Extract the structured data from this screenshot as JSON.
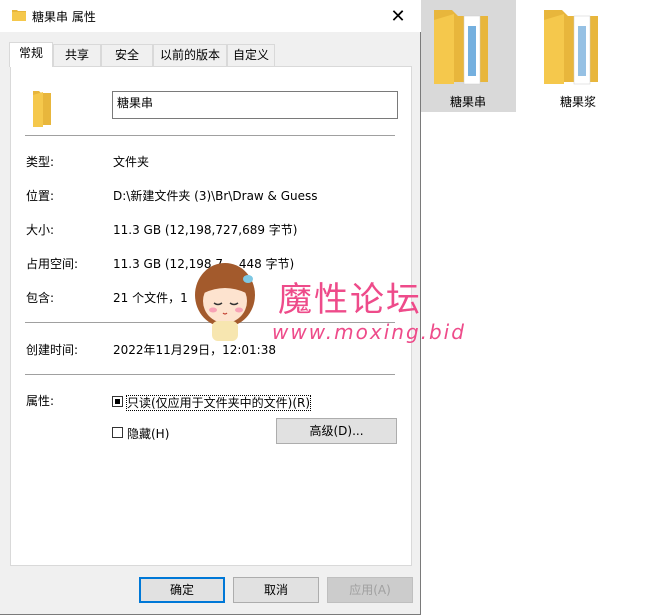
{
  "window": {
    "title": "糖果串 属性",
    "close_glyph": "✕"
  },
  "tabs": [
    {
      "label": "常规",
      "active": true
    },
    {
      "label": "共享"
    },
    {
      "label": "安全"
    },
    {
      "label": "以前的版本"
    },
    {
      "label": "自定义"
    }
  ],
  "general": {
    "name": "糖果串",
    "type_label": "类型:",
    "type_value": "文件夹",
    "location_label": "位置:",
    "location_value": "D:\\新建文件夹 (3)\\Br\\Draw & Guess",
    "size_label": "大小:",
    "size_value": "11.3 GB (12,198,727,689 字节)",
    "size_on_disk_label": "占用空间:",
    "size_on_disk_value": "11.3 GB (12,198,7__,448 字节)",
    "contains_label": "包含:",
    "contains_value": "21 个文件，1",
    "created_label": "创建时间:",
    "created_value": "2022年11月29日，12:01:38",
    "attributes_label": "属性:",
    "readonly_label": "只读(仅应用于文件夹中的文件)(R)",
    "hidden_label": "隐藏(H)",
    "advanced_label": "高级(D)..."
  },
  "footer": {
    "ok": "确定",
    "cancel": "取消",
    "apply": "应用(A)"
  },
  "explorer": {
    "items": [
      {
        "label": "糖果串",
        "selected": true
      },
      {
        "label": "糖果浆",
        "selected": false
      }
    ]
  },
  "watermark": {
    "title": "魔性论坛",
    "url": "www.moxing.bid"
  },
  "colors": {
    "folder": "#f5c84c",
    "accent": "#0078d7",
    "watermark": "#ee4b8a"
  }
}
